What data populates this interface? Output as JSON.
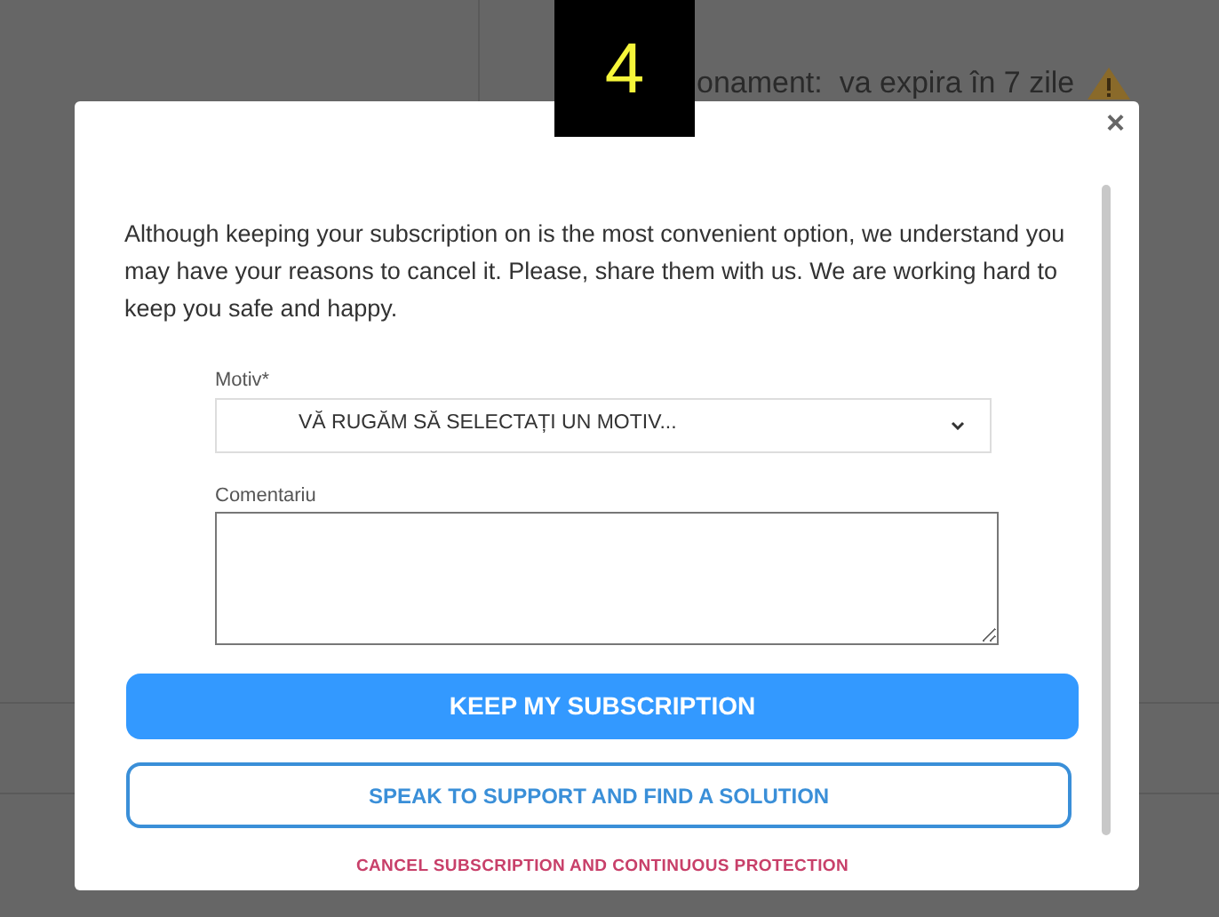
{
  "background": {
    "status_text": "onament:  va expira în 7 zile"
  },
  "step_badge": "4",
  "dialog": {
    "close": "×",
    "message": "Although keeping your subscription on is the most convenient option, we understand you may have your reasons to cancel it. Please, share them with us. We are working hard to keep you safe and happy.",
    "reason": {
      "label": "Motiv*",
      "placeholder": "VĂ RUGĂM SĂ SELECTAȚI UN MOTIV..."
    },
    "comment": {
      "label": "Comentariu"
    },
    "buttons": [
      {
        "kind": "primary",
        "label": "KEEP MY SUBSCRIPTION"
      },
      {
        "kind": "outline",
        "label": "SPEAK TO SUPPORT AND FIND A SOLUTION"
      },
      {
        "kind": "link",
        "label": "CANCEL SUBSCRIPTION AND CONTINUOUS PROTECTION"
      }
    ]
  }
}
